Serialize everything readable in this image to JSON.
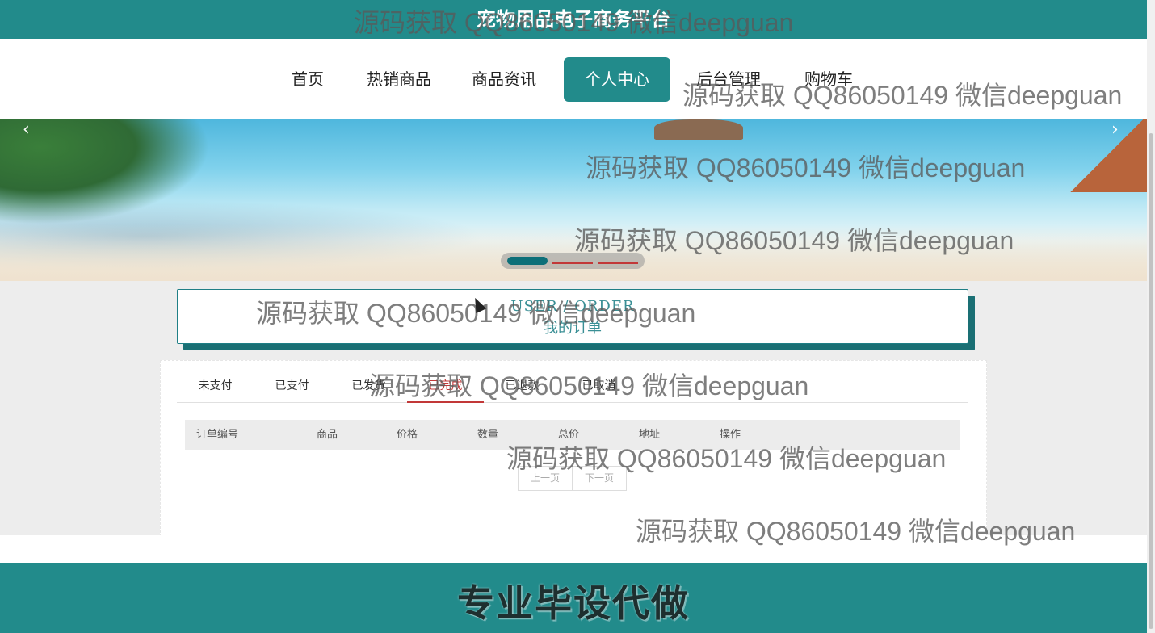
{
  "site": {
    "title": "宠物用品电子商务平台"
  },
  "nav": {
    "items": [
      {
        "label": "首页"
      },
      {
        "label": "热销商品"
      },
      {
        "label": "商品资讯"
      },
      {
        "label": "个人中心",
        "active": true
      },
      {
        "label": "后台管理"
      },
      {
        "label": "购物车"
      }
    ]
  },
  "banner": {
    "prev_icon": "chevron-left-icon",
    "next_icon": "chevron-right-icon",
    "slide_count": 3,
    "active_slide": 1
  },
  "order_section": {
    "title_en": "USER / ORDER",
    "title_cn": "我的订单"
  },
  "tabs": [
    {
      "label": "未支付"
    },
    {
      "label": "已支付"
    },
    {
      "label": "已发货"
    },
    {
      "label": "已完成",
      "active": true
    },
    {
      "label": "已退款"
    },
    {
      "label": "已取消"
    }
  ],
  "table": {
    "columns": [
      "订单编号",
      "商品",
      "价格",
      "数量",
      "总价",
      "地址",
      "操作"
    ],
    "rows": []
  },
  "pager": {
    "prev": "上一页",
    "next": "下一页"
  },
  "footer": {
    "slogan": "专业毕设代做"
  },
  "watermark": "源码获取 QQ86050149 微信deepguan",
  "colors": {
    "primary": "#228b8b",
    "active_tab": "#c23838",
    "background": "#ededed"
  }
}
